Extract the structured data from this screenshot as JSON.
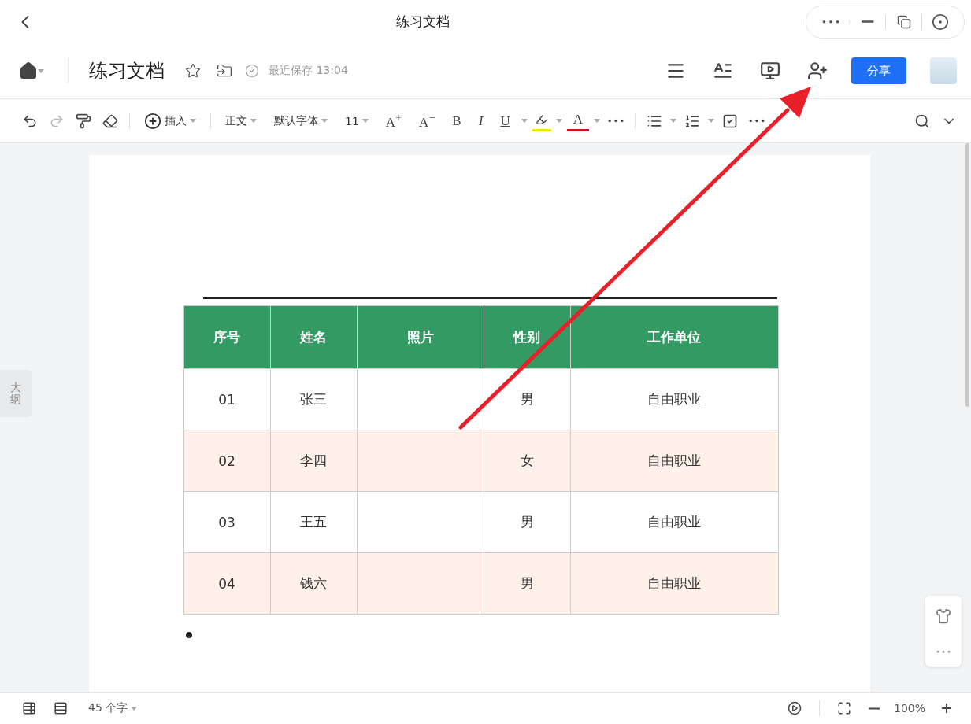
{
  "window": {
    "title": "练习文档"
  },
  "header": {
    "doc_title": "练习文档",
    "save_status": "最近保存 13:04",
    "share_button": "分享"
  },
  "toolbar": {
    "insert": "插入",
    "style": "正文",
    "font": "默认字体",
    "font_size": "11",
    "grow": "A$^{+}$",
    "shrink": "A$^{−}$",
    "bold": "B",
    "italic": "I",
    "underline": "U",
    "font_color": "A"
  },
  "outline_tab": "大纲",
  "table": {
    "columns": [
      "序号",
      "姓名",
      "照片",
      "性别",
      "工作单位"
    ],
    "rows": [
      {
        "cells": [
          "01",
          "张三",
          "",
          "男",
          "自由职业"
        ],
        "shaded": false
      },
      {
        "cells": [
          "02",
          "李四",
          "",
          "女",
          "自由职业"
        ],
        "shaded": true
      },
      {
        "cells": [
          "03",
          "王五",
          "",
          "男",
          "自由职业"
        ],
        "shaded": false
      },
      {
        "cells": [
          "04",
          "钱六",
          "",
          "男",
          "自由职业"
        ],
        "shaded": true
      }
    ]
  },
  "status_bar": {
    "word_count": "45 个字",
    "zoom": "100%"
  }
}
